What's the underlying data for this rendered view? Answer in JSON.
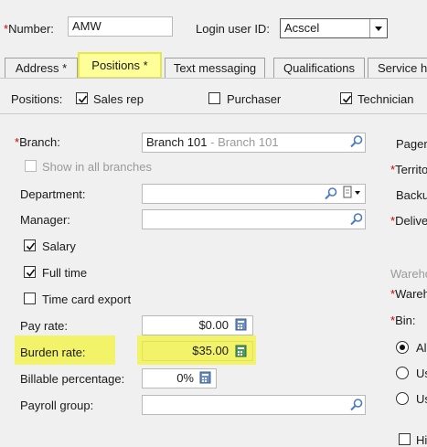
{
  "header": {
    "number_label": "Number:",
    "number_value": "AMW",
    "login_label": "Login user ID:",
    "login_value": "Acscel"
  },
  "tabs": [
    {
      "label": "Address *"
    },
    {
      "label": "Positions *"
    },
    {
      "label": "Text messaging"
    },
    {
      "label": "Qualifications"
    },
    {
      "label": "Service h"
    }
  ],
  "positions": {
    "label": "Positions:",
    "sales_rep": "Sales rep",
    "purchaser": "Purchaser",
    "technician": "Technician"
  },
  "form": {
    "branch_label": "Branch:",
    "branch_code": "Branch 101",
    "branch_sep": " - ",
    "branch_name": "Branch 101",
    "show_all_branches": "Show in all branches",
    "department_label": "Department:",
    "manager_label": "Manager:",
    "salary": "Salary",
    "full_time": "Full time",
    "time_card_export": "Time card export",
    "pay_rate_label": "Pay rate:",
    "pay_rate_value": "$0.00",
    "burden_rate_label": "Burden rate:",
    "burden_rate_value": "$35.00",
    "billable_label": "Billable percentage:",
    "billable_value": "0%",
    "payroll_group_label": "Payroll group:"
  },
  "right_panel": {
    "pager": "Pager",
    "territory": "Territo",
    "backup": "Backu",
    "delivery": "Delive",
    "warehouse_header": "Wareho",
    "warehouse": "Wareh",
    "bin": "Bin:",
    "opt1": "Al",
    "opt2": "Us",
    "opt3": "Us",
    "bottom_cb": "Hi"
  },
  "colors": {
    "highlight": "#f3f36a",
    "required": "#d00000"
  }
}
